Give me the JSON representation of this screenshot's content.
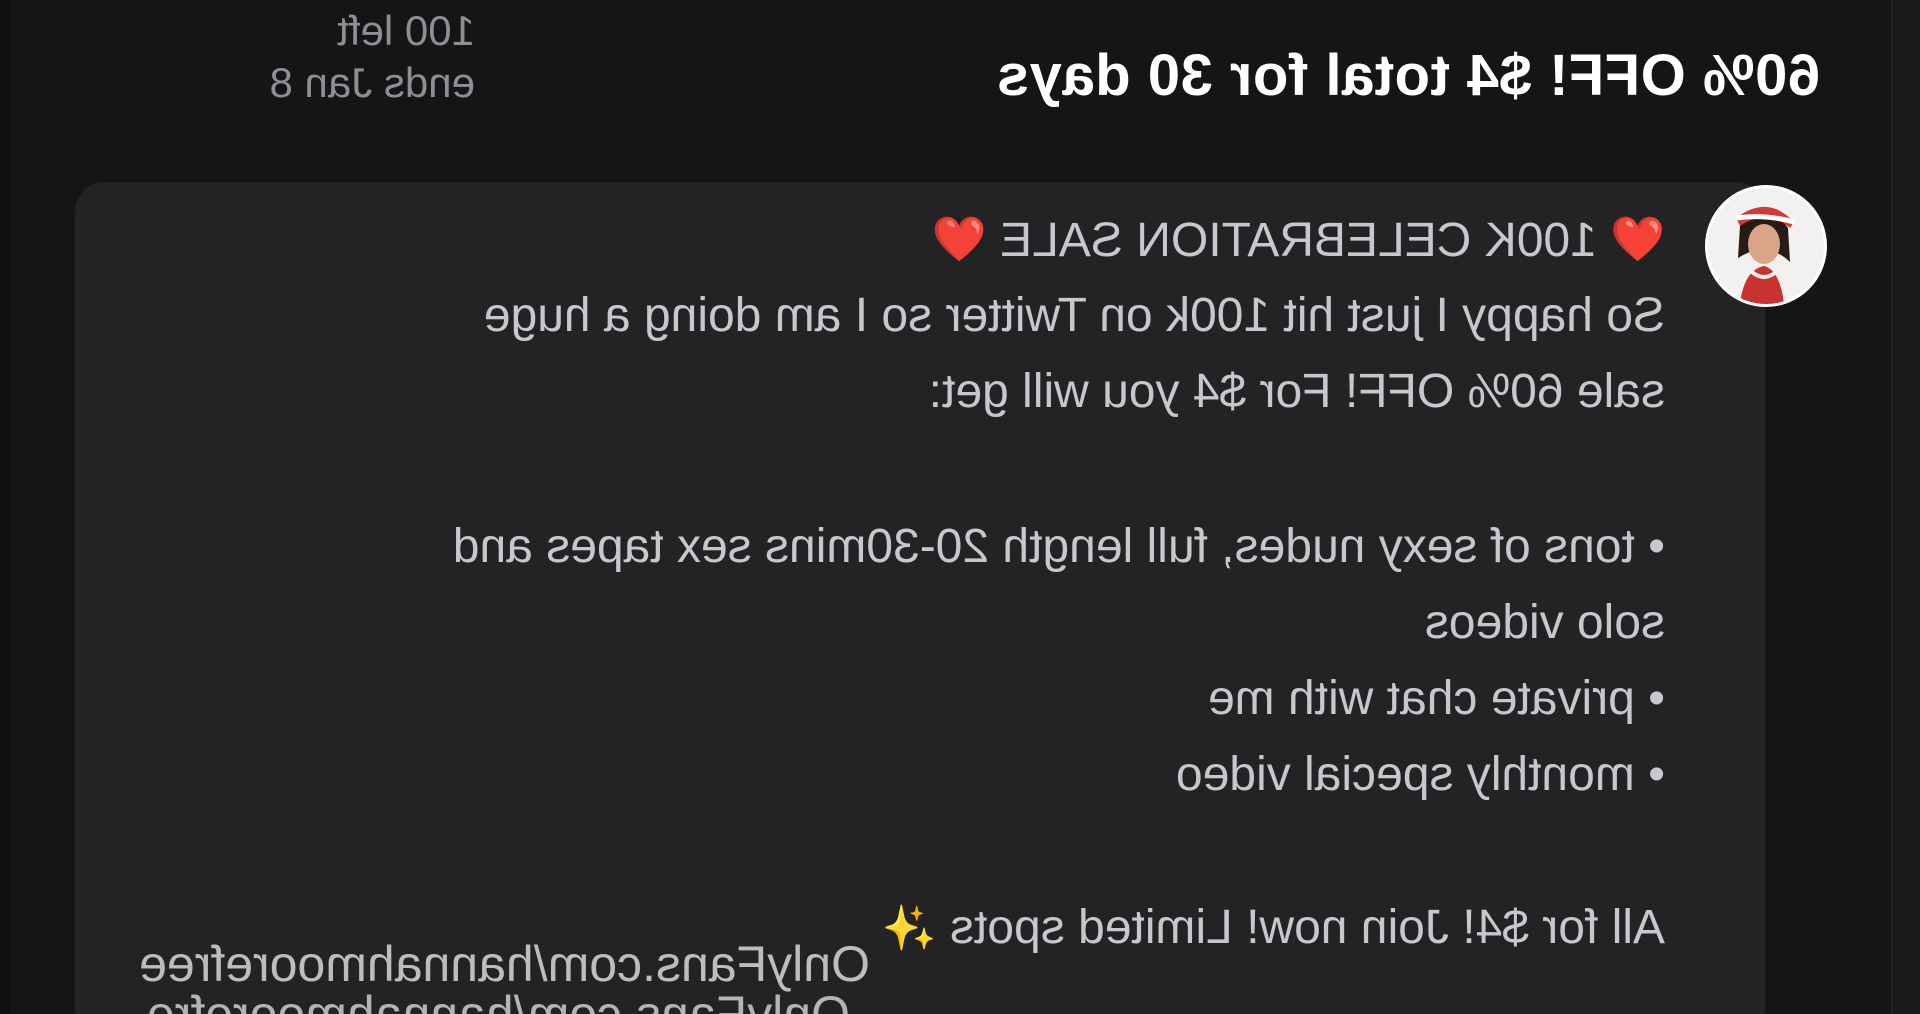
{
  "offer": {
    "title": "60% OFF! $4 total for 30 days",
    "remaining": "100 left",
    "ends": "ends Jan 8"
  },
  "message": {
    "avatar_icon": "profile-avatar",
    "heading_prefix": "❤️",
    "heading": "100K CELEBRATION SALE",
    "heading_suffix": "❤️",
    "intro_line_1": "So happy I just hit 100k on Twitter so I am doing a huge",
    "intro_line_2": "sale 60% OFF! For $4 you will get:",
    "bullets": [
      {
        "line_1": "tons of sexy nudes, full length 20-30mins sex tapes and",
        "line_2": "solo videos"
      },
      {
        "line_1": "private chat with me"
      },
      {
        "line_1": "monthly special video"
      }
    ],
    "bullet_char": "•",
    "closing": "All for $4! Join now! Limited spots",
    "sparkle": "✨"
  },
  "link_overlay": {
    "line_1": "OnlyFans.com/hannahmoorefree",
    "line_2": "OnlyFans.com/hannahmoorefre"
  },
  "colors": {
    "background": "#151517",
    "bubble": "#232326",
    "text": "#c7c7cc",
    "muted": "#8e8e93",
    "title": "#ffffff",
    "heart": "#e0202a"
  }
}
